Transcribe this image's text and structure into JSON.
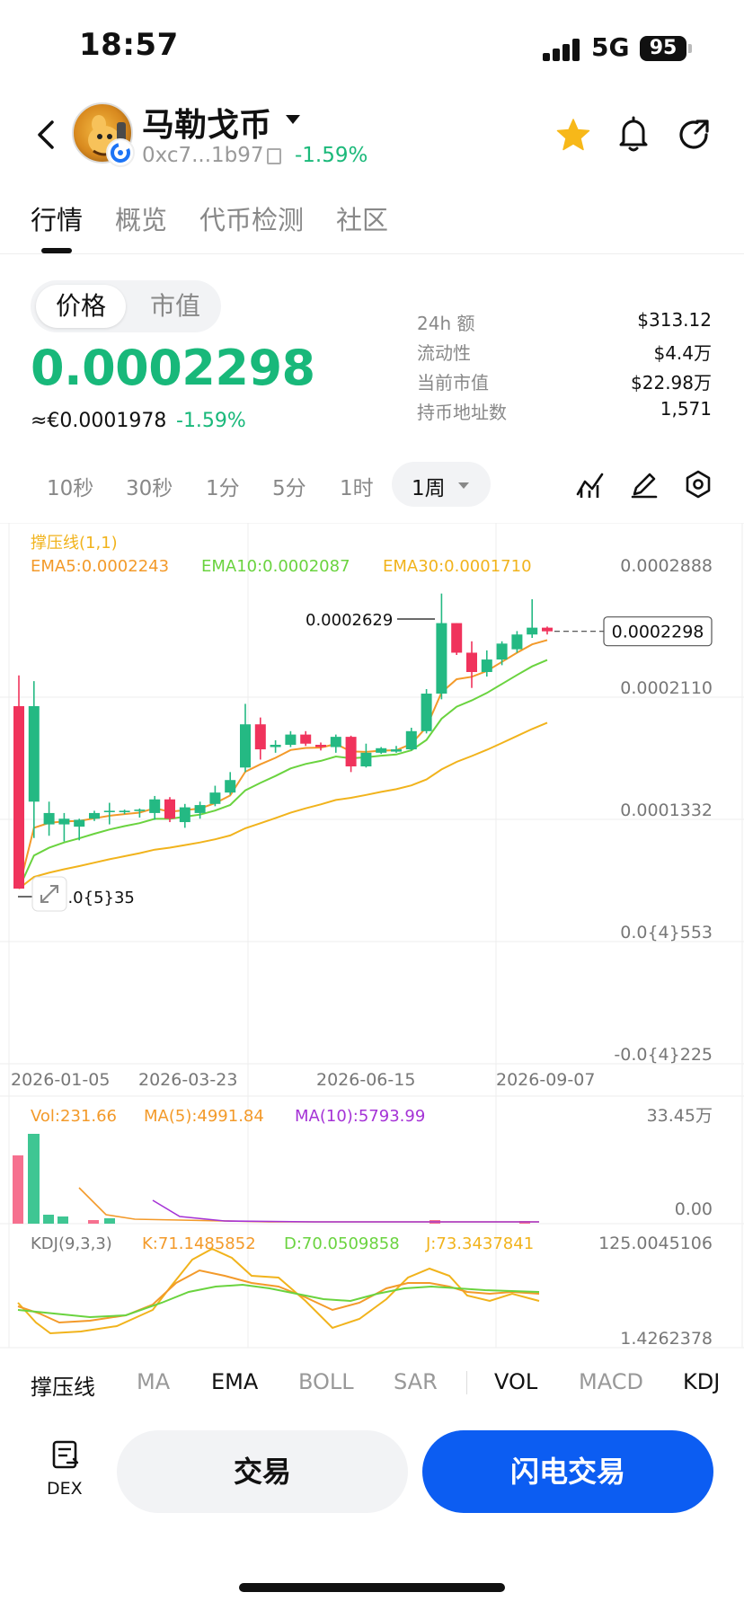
{
  "status_bar": {
    "time": "18:57",
    "network": "5G",
    "battery": "95"
  },
  "header": {
    "coin_name": "马勒戈币",
    "address": "0xc7...1b97",
    "change": "-1.59%",
    "icons": [
      "back-icon",
      "star-icon",
      "bell-icon",
      "share-icon"
    ]
  },
  "tabs": [
    "行情",
    "概览",
    "代币检测",
    "社区"
  ],
  "price_toggle": {
    "active": "价格",
    "inactive": "市值"
  },
  "price": {
    "value": "0.0002298",
    "fiat": "≈€0.0001978",
    "fiat_change": "-1.59%"
  },
  "stats": [
    {
      "label": "24h  额",
      "value": "$313.12"
    },
    {
      "label": "流动性",
      "value": "$4.4万"
    },
    {
      "label": "当前市值",
      "value": "$22.98万"
    },
    {
      "label": "持币地址数",
      "value": "1,571"
    }
  ],
  "timeframes": [
    "10秒",
    "30秒",
    "1分",
    "5分",
    "1时"
  ],
  "timeframe_active": "1周",
  "chart_tools": [
    "indicator-icon",
    "draw-icon",
    "settings-icon"
  ],
  "chart_labels": {
    "indicator": "撑压线(1,1)",
    "ema5": "EMA5:0.0002243",
    "ema10": "EMA10:0.0002087",
    "ema30": "EMA30:0.0001710",
    "y_ticks": [
      "0.0002888",
      "0.0002110",
      "0.0001332",
      "0.0{4}553",
      "-0.0{4}225"
    ],
    "high_label": "0.0002629",
    "low_label": "0.0{5}35",
    "current_price": "0.0002298",
    "x_ticks": [
      "2026-01-05",
      "2026-03-23",
      "2026-06-15",
      "2026-09-07"
    ],
    "vol": "Vol:231.66",
    "vol_ma5": "MA(5):4991.84",
    "vol_ma10": "MA(10):5793.99",
    "vol_ticks": [
      "33.45万",
      "0.00"
    ],
    "kdj": "KDJ(9,3,3)",
    "kdj_k": "K:71.1485852",
    "kdj_d": "D:70.0509858",
    "kdj_j": "J:73.3437841",
    "kdj_ticks": [
      "125.0045106",
      "1.4262378"
    ]
  },
  "colors": {
    "up": "#f0335c",
    "down": "#24b983",
    "ema5": "#f39a2a",
    "ema10": "#6ad33f",
    "ema30": "#f1b31c",
    "ma10": "#a533d6",
    "brand": "#0c5df2"
  },
  "chart_data": {
    "type": "candlestick",
    "x_ticks": [
      "2026-01-05",
      "2026-03-23",
      "2026-06-15",
      "2026-09-07"
    ],
    "ylim": [
      -2.25e-05,
      0.0002888
    ],
    "candles": [
      {
        "o": 0.000164,
        "h": 0.000191,
        "l": 3.5e-06,
        "c": 3.5e-06
      },
      {
        "o": 8e-05,
        "h": 0.000186,
        "l": 4.8e-05,
        "c": 0.000164
      },
      {
        "o": 6e-05,
        "h": 8e-05,
        "l": 5e-05,
        "c": 7e-05
      },
      {
        "o": 6e-05,
        "h": 7e-05,
        "l": 4.5e-05,
        "c": 6.5e-05
      },
      {
        "o": 5.8e-05,
        "h": 6.5e-05,
        "l": 4.6e-05,
        "c": 6.4e-05
      },
      {
        "o": 6.5e-05,
        "h": 7.2e-05,
        "l": 6.3e-05,
        "c": 7e-05
      },
      {
        "o": 7.2e-05,
        "h": 7.9e-05,
        "l": 6e-05,
        "c": 7.2e-05
      },
      {
        "o": 7.2e-05,
        "h": 7.3e-05,
        "l": 6.9e-05,
        "c": 7.2e-05
      },
      {
        "o": 7.2e-05,
        "h": 7.4e-05,
        "l": 6.6e-05,
        "c": 7.3e-05
      },
      {
        "o": 7e-05,
        "h": 8.5e-05,
        "l": 6.4e-05,
        "c": 8.2e-05
      },
      {
        "o": 8.2e-05,
        "h": 8.4e-05,
        "l": 6.2e-05,
        "c": 6.5e-05
      },
      {
        "o": 6.2e-05,
        "h": 7.8e-05,
        "l": 5.7e-05,
        "c": 7.5e-05
      },
      {
        "o": 7e-05,
        "h": 8e-05,
        "l": 6.5e-05,
        "c": 7.7e-05
      },
      {
        "o": 7.8e-05,
        "h": 9.4e-05,
        "l": 7.6e-05,
        "c": 8.8e-05
      },
      {
        "o": 8.8e-05,
        "h": 0.000106,
        "l": 8.6e-05,
        "c": 9.9e-05
      },
      {
        "o": 0.00011,
        "h": 0.000166,
        "l": 0.000106,
        "c": 0.000148
      },
      {
        "o": 0.000148,
        "h": 0.000154,
        "l": 0.000117,
        "c": 0.000126
      },
      {
        "o": 0.000128,
        "h": 0.000134,
        "l": 0.000123,
        "c": 0.00013
      },
      {
        "o": 0.00013,
        "h": 0.000142,
        "l": 0.000128,
        "c": 0.000139
      },
      {
        "o": 0.000139,
        "h": 0.000142,
        "l": 0.000129,
        "c": 0.000131
      },
      {
        "o": 0.00013,
        "h": 0.000132,
        "l": 0.000125,
        "c": 0.000128
      },
      {
        "o": 0.000128,
        "h": 0.000139,
        "l": 0.000123,
        "c": 0.000137
      },
      {
        "o": 0.000137,
        "h": 0.000138,
        "l": 0.000106,
        "c": 0.000111
      },
      {
        "o": 0.000111,
        "h": 0.000131,
        "l": 0.00011,
        "c": 0.000123
      },
      {
        "o": 0.000123,
        "h": 0.000128,
        "l": 0.000122,
        "c": 0.000127
      },
      {
        "o": 0.000124,
        "h": 0.000129,
        "l": 0.000123,
        "c": 0.000126
      },
      {
        "o": 0.000126,
        "h": 0.000145,
        "l": 0.000125,
        "c": 0.000142
      },
      {
        "o": 0.000142,
        "h": 0.000179,
        "l": 0.00014,
        "c": 0.000175
      },
      {
        "o": 0.000175,
        "h": 0.000263,
        "l": 0.00017,
        "c": 0.000237
      },
      {
        "o": 0.000237,
        "h": 0.000237,
        "l": 0.000209,
        "c": 0.000211
      },
      {
        "o": 0.000211,
        "h": 0.000221,
        "l": 0.00018,
        "c": 0.000194
      },
      {
        "o": 0.000194,
        "h": 0.000213,
        "l": 0.00019,
        "c": 0.000205
      },
      {
        "o": 0.000205,
        "h": 0.000221,
        "l": 0.0002,
        "c": 0.000219
      },
      {
        "o": 0.000214,
        "h": 0.00023,
        "l": 0.000211,
        "c": 0.000227
      },
      {
        "o": 0.000227,
        "h": 0.000258,
        "l": 0.000224,
        "c": 0.000233
      },
      {
        "o": 0.000233,
        "h": 0.000234,
        "l": 0.000227,
        "c": 0.0002298
      }
    ],
    "current_price": 0.0002298,
    "marked_high": 0.0002629,
    "marked_low": 3.5e-06
  }
}
